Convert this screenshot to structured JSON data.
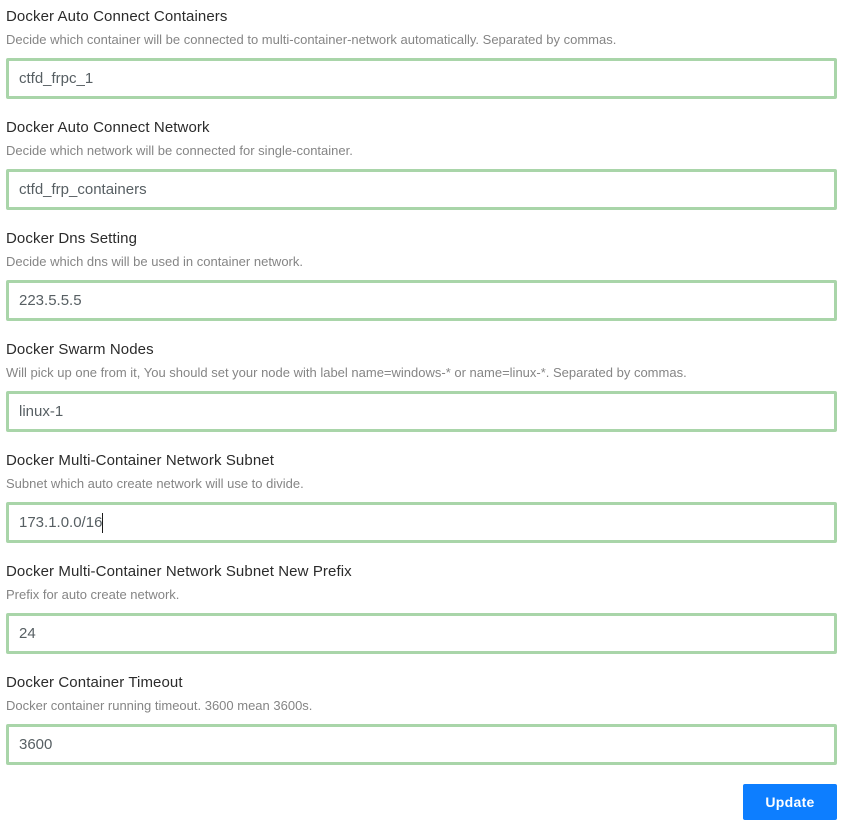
{
  "colors": {
    "input_border_valid": "#a9d5a9",
    "button_primary": "#0d7eff",
    "label_text": "#2b2b2b",
    "description_text": "#858585",
    "input_text": "#575f63"
  },
  "fields": [
    {
      "label": "Docker Auto Connect Containers",
      "description": "Decide which container will be connected to multi-container-network automatically. Separated by commas.",
      "value": "ctfd_frpc_1"
    },
    {
      "label": "Docker Auto Connect Network",
      "description": "Decide which network will be connected for single-container.",
      "value": "ctfd_frp_containers"
    },
    {
      "label": "Docker Dns Setting",
      "description": "Decide which dns will be used in container network.",
      "value": "223.5.5.5"
    },
    {
      "label": "Docker Swarm Nodes",
      "description": "Will pick up one from it, You should set your node with label name=windows-* or name=linux-*. Separated by commas.",
      "value": "linux-1"
    },
    {
      "label": "Docker Multi-Container Network Subnet",
      "description": "Subnet which auto create network will use to divide.",
      "value": "173.1.0.0/16"
    },
    {
      "label": "Docker Multi-Container Network Subnet New Prefix",
      "description": "Prefix for auto create network.",
      "value": "24"
    },
    {
      "label": "Docker Container Timeout",
      "description": "Docker container running timeout. 3600 mean 3600s.",
      "value": "3600"
    }
  ],
  "submit": {
    "label": "Update"
  }
}
